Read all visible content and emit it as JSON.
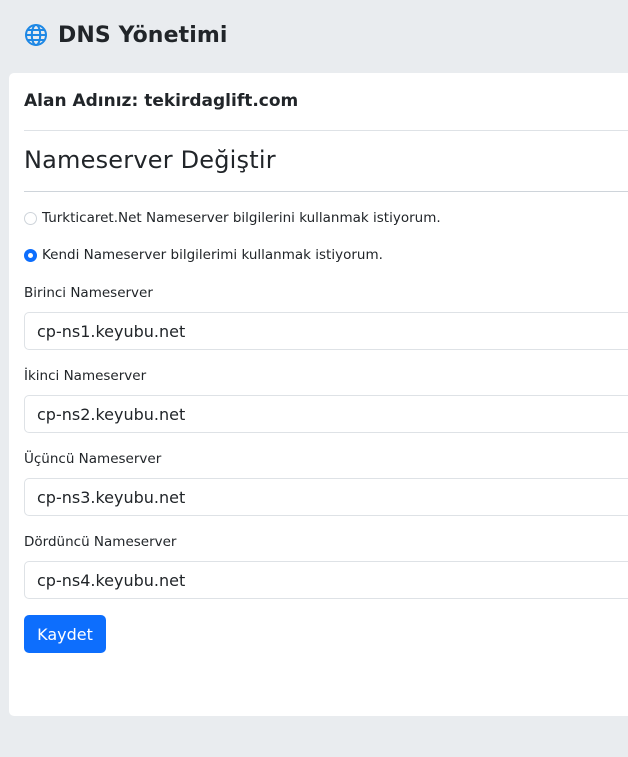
{
  "header": {
    "title": "DNS Yönetimi",
    "icon": "globe-icon",
    "icon_color": "#1e88e5"
  },
  "card": {
    "domain_label": "Alan Adınız:",
    "domain_value": "tekirdaglift.com",
    "section_title": "Nameserver Değiştir"
  },
  "options": [
    {
      "label": "Turkticaret.Net Nameserver bilgilerini kullanmak istiyorum.",
      "selected": false
    },
    {
      "label": "Kendi Nameserver bilgilerimi kullanmak istiyorum.",
      "selected": true
    }
  ],
  "fields": [
    {
      "label": "Birinci Nameserver",
      "value": "cp-ns1.keyubu.net"
    },
    {
      "label": "İkinci Nameserver",
      "value": "cp-ns2.keyubu.net"
    },
    {
      "label": "Üçüncü Nameserver",
      "value": "cp-ns3.keyubu.net"
    },
    {
      "label": "Dördüncü Nameserver",
      "value": "cp-ns4.keyubu.net"
    }
  ],
  "save_button": {
    "label": "Kaydet",
    "color": "#0d6efd"
  }
}
